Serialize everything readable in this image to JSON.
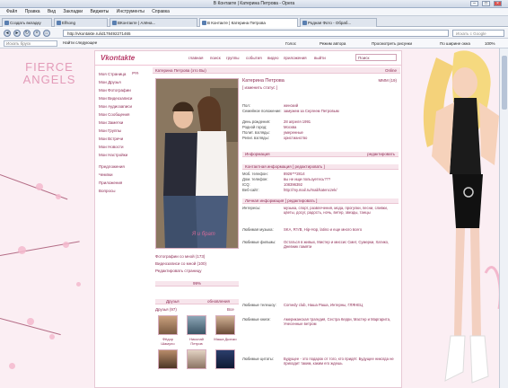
{
  "window": {
    "title": "В Контакте | Катерина Петрова - Opera"
  },
  "menu": [
    "Файл",
    "Правка",
    "Вид",
    "Закладки",
    "Виджеты",
    "Инструменты",
    "Справка"
  ],
  "tabs": [
    {
      "label": "Создать вкладку"
    },
    {
      "label": "Elfsong"
    },
    {
      "label": "ВКонтакте | Алёна..."
    },
    {
      "label": "В Контакте | Катерина Петрова"
    },
    {
      "label": "Родная Фото - Обраб..."
    }
  ],
  "nav": {
    "address": "http://vkontakte.ru/id178492271465",
    "search_placeholder": "Искать с Google"
  },
  "toolbar2": {
    "left_placeholder": "Искать бруск",
    "feed": "Найти следующее",
    "items": [
      "Голос",
      "Режим автора",
      "Просмотреть рисунки",
      "По ширине окна",
      "100%"
    ]
  },
  "page": {
    "logo_line1": "FIERCE",
    "logo_line2": "ANGELS"
  },
  "vk": {
    "logo": "Vkontakte",
    "topnav": [
      "главная",
      "поиск",
      "группы",
      "события",
      "видео",
      "приложения",
      "выйти"
    ],
    "search_value": "Поиск",
    "leftnav": [
      "Моя Страница",
      "Мои Друзья",
      "Мои Фотографии",
      "Мои Видеозаписи",
      "Мои Аудиозаписи",
      "Мои Сообщения",
      "Мои Заметки",
      "Мои Группы",
      "Мои Встречи",
      "Мои Новости",
      "Мои Настройки",
      "Предложения",
      "Чемпки",
      "Приложения",
      "Вопросы"
    ],
    "leftnav_edit": "ред.",
    "profile_header": "Катерина Петрова (это Вы)",
    "online": "Online",
    "photo_caption": "Я и брат",
    "photo_links": [
      "Фотографии со мной (173)",
      "Видеозаписи со мной (100)",
      "Редактировать страницу"
    ],
    "progress_label": "99%",
    "friends_header": "Друзья",
    "friends_link": "обновления",
    "friends_count": "Друзья (97)",
    "friends_all": "Все",
    "friends": [
      {
        "name": "Фёдор Шамуло"
      },
      {
        "name": "Николай Петров"
      },
      {
        "name": "Маша Дьячко"
      }
    ],
    "name": "Катерина Петрова",
    "status_edit": "[ изменить статус ]",
    "mmm": "МММ (19)",
    "basic": [
      {
        "k": "Пол:",
        "v": "женский"
      },
      {
        "k": "Семейное положение:",
        "v": "замужем за Сергеем Петровым"
      },
      {
        "k": "День рождения:",
        "v": "28 апреля 1991"
      },
      {
        "k": "Родной город:",
        "v": "Москва"
      },
      {
        "k": "Полит. взгляды:",
        "v": "умеренные"
      },
      {
        "k": "Религ. взгляды:",
        "v": "христианство"
      }
    ],
    "sections": {
      "info": "Информация",
      "edit": "редактировать",
      "contact": "Контактная информация",
      "contact_edit": "[ редактировать ]",
      "personal": "Личная информация",
      "personal_edit": "[ редактировать ]"
    },
    "contact": [
      {
        "k": "Моб. телефон:",
        "v": "8926***2814"
      },
      {
        "k": "Дом. телефон:",
        "v": "вы не ищи пользуетесь???"
      },
      {
        "k": "ICQ:",
        "v": "108396392"
      },
      {
        "k": "Веб-сайт:",
        "v": "http://my.mail.ru/mail/katenczek/"
      }
    ],
    "personal": [
      {
        "k": "Интересы:",
        "v": "музыка, спорт, развлечения, мода, прогулки, песни, сливки, цветы, досуг, радость, ночь, ветер, звезды, танцы"
      },
      {
        "k": "Любимая музыка:",
        "v": "SKA, R'n'B, Hip-Hop, latino и еще много всего"
      },
      {
        "k": "Любимые фильмы:",
        "v": "Остаться в живых, Мистер и миссис Смит, Сумерки, Хатико, Дневник памяти"
      },
      {
        "k": "Любимые телешоу:",
        "v": "Comedy club, Наша Раша, Интерны, ГЛЯНЕЦ"
      },
      {
        "k": "Любимые книги:",
        "v": "Американская трагедия, Сестра Керри, Мастер и Маргарита, Унесенные ветром"
      },
      {
        "k": "Любимые цитаты:",
        "v": "Будущее - это подарок от того, кто придёт. Будущее никогда не приходит таким, каким его ждешь"
      }
    ]
  },
  "colors": {
    "accent": "#8d2a53",
    "page_bg": "#fbeef3",
    "section_bg": "#f7e5ec"
  }
}
